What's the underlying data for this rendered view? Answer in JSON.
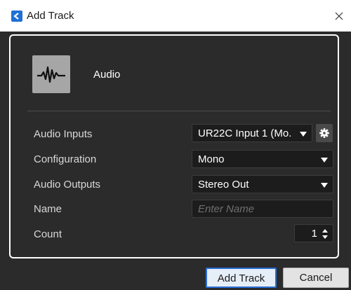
{
  "window": {
    "title": "Add Track"
  },
  "track_type": {
    "label": "Audio",
    "icon": "waveform-icon"
  },
  "fields": {
    "audio_inputs": {
      "label": "Audio Inputs",
      "value": "UR22C Input 1 (Mo."
    },
    "configuration": {
      "label": "Configuration",
      "value": "Mono"
    },
    "audio_outputs": {
      "label": "Audio Outputs",
      "value": "Stereo Out"
    },
    "name": {
      "label": "Name",
      "value": "",
      "placeholder": "Enter Name"
    },
    "count": {
      "label": "Count",
      "value": "1"
    }
  },
  "buttons": {
    "add_track": "Add Track",
    "cancel": "Cancel"
  },
  "colors": {
    "accent": "#2a6fd6",
    "background": "#2b2b2b",
    "field": "#1c1c1c"
  }
}
